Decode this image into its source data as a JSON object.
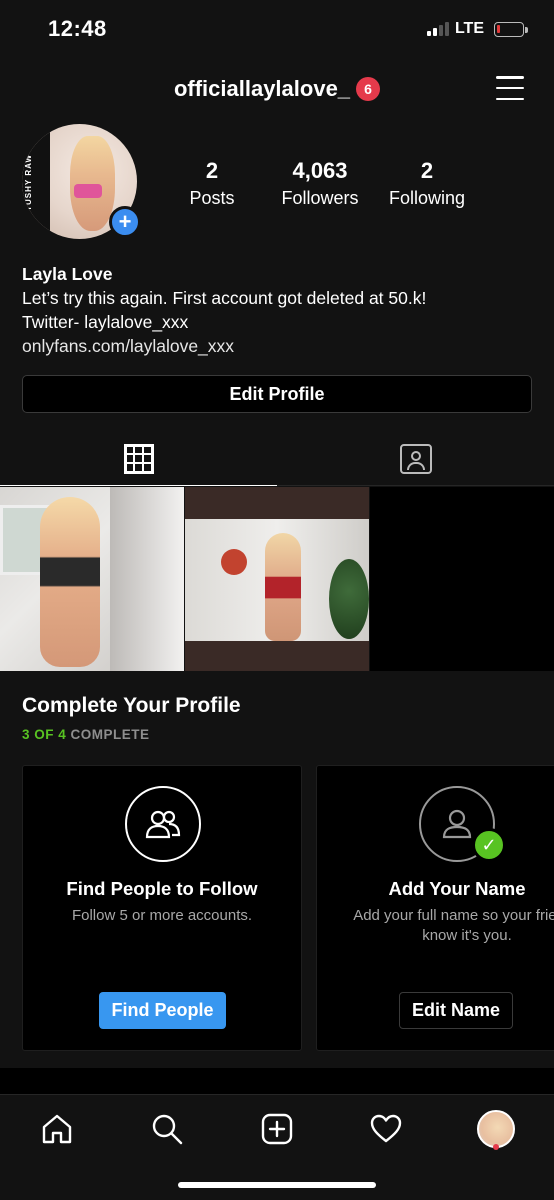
{
  "status_bar": {
    "time": "12:48",
    "network": "LTE",
    "battery_level": 0.05,
    "battery_color": "#e23a3a"
  },
  "header": {
    "username": "officiallaylalove_",
    "notification_count": "6",
    "menu_icon": "hamburger-menu-icon"
  },
  "profile": {
    "avatar_text": "TUSHY RAW",
    "add_story_icon": "plus-icon",
    "stats": {
      "posts": {
        "value": "2",
        "label": "Posts"
      },
      "followers": {
        "value": "4,063",
        "label": "Followers"
      },
      "following": {
        "value": "2",
        "label": "Following"
      }
    },
    "name": "Layla Love",
    "bio_line1": "Let’s try this again. First account got deleted at 50.k!",
    "bio_line2": "Twitter- laylalove_xxx",
    "bio_link": "onlyfans.com/laylalove_xxx",
    "edit_button": "Edit Profile"
  },
  "tabs": {
    "grid_icon": "grid-icon",
    "tagged_icon": "tagged-person-icon",
    "active": "grid"
  },
  "complete_profile": {
    "title": "Complete Your Profile",
    "progress": "3 OF 4",
    "progress_suffix": " COMPLETE",
    "progress_color": "#58c322",
    "cards": [
      {
        "icon": "people-icon",
        "title": "Find People to Follow",
        "description": "Follow 5 or more accounts.",
        "button": "Find People",
        "completed": false
      },
      {
        "icon": "person-icon",
        "title": "Add Your Name",
        "description": "Add your full name so your friends know it's you.",
        "button": "Edit Name",
        "completed": true
      }
    ]
  },
  "bottom_nav": {
    "items": [
      "home-icon",
      "search-icon",
      "add-post-icon",
      "heart-icon",
      "profile-avatar"
    ]
  },
  "colors": {
    "accent_blue": "#3897f0",
    "badge_red": "#e53a4b",
    "background": "#121212"
  }
}
